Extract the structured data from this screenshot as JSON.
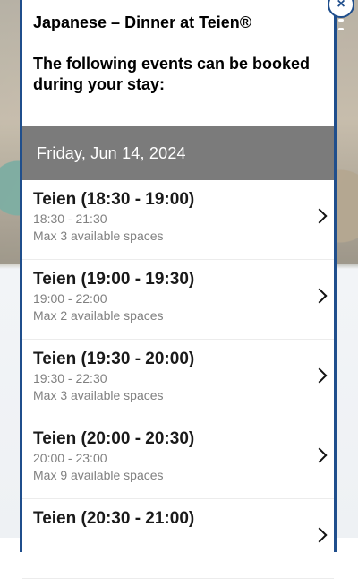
{
  "modal": {
    "title": "Japanese – Dinner at Teien®",
    "subtitle": "The following events can be booked during your stay:",
    "close_icon": "×"
  },
  "date_header": "Friday, Jun 14, 2024",
  "events": [
    {
      "title": "Teien (18:30 - 19:00)",
      "time": "18:30 - 21:30",
      "spaces": "Max 3 available spaces"
    },
    {
      "title": "Teien (19:00 - 19:30)",
      "time": "19:00 - 22:00",
      "spaces": "Max 2 available spaces"
    },
    {
      "title": "Teien (19:30 - 20:00)",
      "time": "19:30 - 22:30",
      "spaces": "Max 3 available spaces"
    },
    {
      "title": "Teien (20:00 - 20:30)",
      "time": "20:00 - 23:00",
      "spaces": "Max 9 available spaces"
    },
    {
      "title": "Teien (20:30 - 21:00)",
      "time": "",
      "spaces": ""
    }
  ],
  "colors": {
    "accent": "#1f4e8c",
    "date_bar": "#7b7b7b"
  }
}
